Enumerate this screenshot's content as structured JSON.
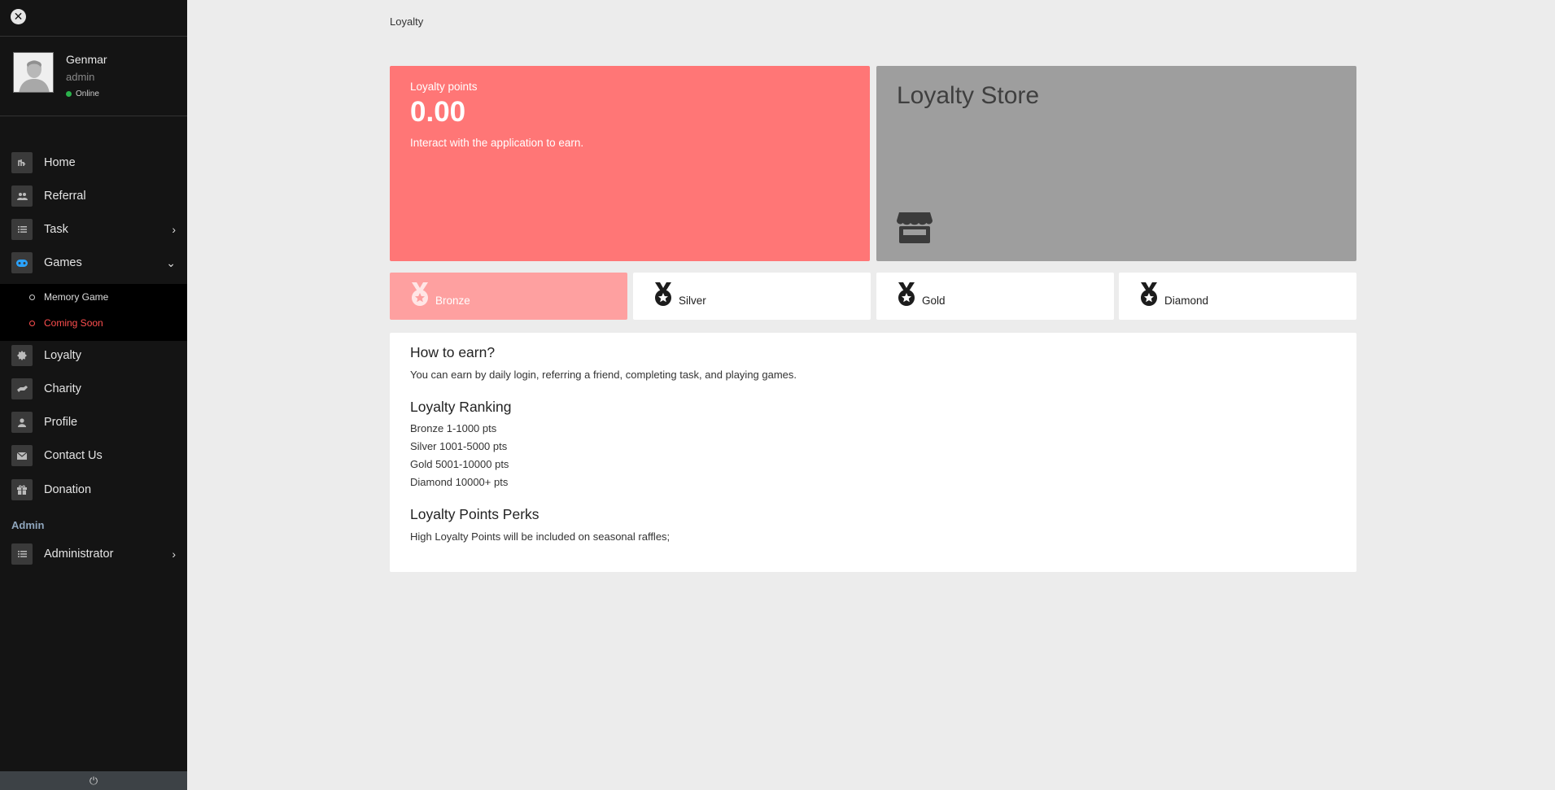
{
  "sidebar": {
    "close_icon": "close-icon",
    "user": {
      "name": "Genmar",
      "role": "admin",
      "status": "Online"
    },
    "items": [
      {
        "label": "Home",
        "icon": "home-icon"
      },
      {
        "label": "Referral",
        "icon": "users-icon"
      },
      {
        "label": "Task",
        "icon": "list-icon"
      },
      {
        "label": "Games",
        "icon": "gamepad-icon"
      },
      {
        "label": "Loyalty",
        "icon": "badge-icon"
      },
      {
        "label": "Charity",
        "icon": "hand-icon"
      },
      {
        "label": "Profile",
        "icon": "user-icon"
      },
      {
        "label": "Contact Us",
        "icon": "envelope-icon"
      },
      {
        "label": "Donation",
        "icon": "gift-icon"
      }
    ],
    "games_sub": [
      {
        "label": "Memory Game"
      },
      {
        "label": "Coming Soon"
      }
    ],
    "admin_header": "Admin",
    "admin_items": [
      {
        "label": "Administrator",
        "icon": "list-icon"
      }
    ],
    "footer_icon": "power-icon"
  },
  "breadcrumb": "Loyalty",
  "points_card": {
    "label": "Loyalty points",
    "value": "0.00",
    "subtitle": "Interact with the application to earn."
  },
  "store_card": {
    "title": "Loyalty Store",
    "icon": "store-icon"
  },
  "tiers": [
    {
      "label": "Bronze",
      "active": true
    },
    {
      "label": "Silver",
      "active": false
    },
    {
      "label": "Gold",
      "active": false
    },
    {
      "label": "Diamond",
      "active": false
    }
  ],
  "info": {
    "earn_heading": "How to earn?",
    "earn_text": "You can earn by daily login, referring a friend, completing task, and playing games.",
    "ranking_heading": "Loyalty Ranking",
    "ranking_lines": [
      "Bronze 1-1000 pts",
      "Silver 1001-5000 pts",
      "Gold 5001-10000 pts",
      "Diamond 10000+ pts"
    ],
    "perks_heading": "Loyalty Points Perks",
    "perks_text": "High Loyalty Points will be included on seasonal raffles;"
  },
  "colors": {
    "sidebar_bg": "#141414",
    "points_card": "#ff7676",
    "store_card": "#9e9e9e",
    "active_tier": "#fea0a0",
    "coming_soon": "#ff4f4f",
    "admin_header": "#8fa6bd",
    "online": "#2bb24c"
  }
}
